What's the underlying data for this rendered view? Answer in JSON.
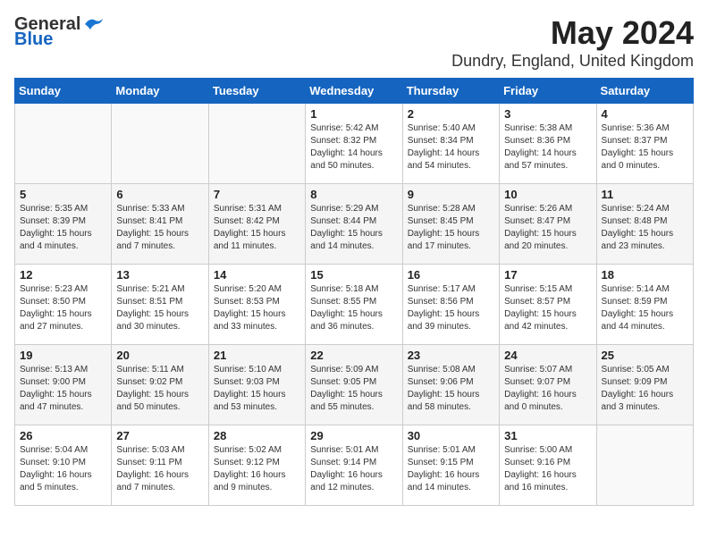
{
  "header": {
    "logo_general": "General",
    "logo_blue": "Blue",
    "month": "May 2024",
    "location": "Dundry, England, United Kingdom"
  },
  "days_of_week": [
    "Sunday",
    "Monday",
    "Tuesday",
    "Wednesday",
    "Thursday",
    "Friday",
    "Saturday"
  ],
  "weeks": [
    [
      {
        "day": "",
        "info": ""
      },
      {
        "day": "",
        "info": ""
      },
      {
        "day": "",
        "info": ""
      },
      {
        "day": "1",
        "info": "Sunrise: 5:42 AM\nSunset: 8:32 PM\nDaylight: 14 hours\nand 50 minutes."
      },
      {
        "day": "2",
        "info": "Sunrise: 5:40 AM\nSunset: 8:34 PM\nDaylight: 14 hours\nand 54 minutes."
      },
      {
        "day": "3",
        "info": "Sunrise: 5:38 AM\nSunset: 8:36 PM\nDaylight: 14 hours\nand 57 minutes."
      },
      {
        "day": "4",
        "info": "Sunrise: 5:36 AM\nSunset: 8:37 PM\nDaylight: 15 hours\nand 0 minutes."
      }
    ],
    [
      {
        "day": "5",
        "info": "Sunrise: 5:35 AM\nSunset: 8:39 PM\nDaylight: 15 hours\nand 4 minutes."
      },
      {
        "day": "6",
        "info": "Sunrise: 5:33 AM\nSunset: 8:41 PM\nDaylight: 15 hours\nand 7 minutes."
      },
      {
        "day": "7",
        "info": "Sunrise: 5:31 AM\nSunset: 8:42 PM\nDaylight: 15 hours\nand 11 minutes."
      },
      {
        "day": "8",
        "info": "Sunrise: 5:29 AM\nSunset: 8:44 PM\nDaylight: 15 hours\nand 14 minutes."
      },
      {
        "day": "9",
        "info": "Sunrise: 5:28 AM\nSunset: 8:45 PM\nDaylight: 15 hours\nand 17 minutes."
      },
      {
        "day": "10",
        "info": "Sunrise: 5:26 AM\nSunset: 8:47 PM\nDaylight: 15 hours\nand 20 minutes."
      },
      {
        "day": "11",
        "info": "Sunrise: 5:24 AM\nSunset: 8:48 PM\nDaylight: 15 hours\nand 23 minutes."
      }
    ],
    [
      {
        "day": "12",
        "info": "Sunrise: 5:23 AM\nSunset: 8:50 PM\nDaylight: 15 hours\nand 27 minutes."
      },
      {
        "day": "13",
        "info": "Sunrise: 5:21 AM\nSunset: 8:51 PM\nDaylight: 15 hours\nand 30 minutes."
      },
      {
        "day": "14",
        "info": "Sunrise: 5:20 AM\nSunset: 8:53 PM\nDaylight: 15 hours\nand 33 minutes."
      },
      {
        "day": "15",
        "info": "Sunrise: 5:18 AM\nSunset: 8:55 PM\nDaylight: 15 hours\nand 36 minutes."
      },
      {
        "day": "16",
        "info": "Sunrise: 5:17 AM\nSunset: 8:56 PM\nDaylight: 15 hours\nand 39 minutes."
      },
      {
        "day": "17",
        "info": "Sunrise: 5:15 AM\nSunset: 8:57 PM\nDaylight: 15 hours\nand 42 minutes."
      },
      {
        "day": "18",
        "info": "Sunrise: 5:14 AM\nSunset: 8:59 PM\nDaylight: 15 hours\nand 44 minutes."
      }
    ],
    [
      {
        "day": "19",
        "info": "Sunrise: 5:13 AM\nSunset: 9:00 PM\nDaylight: 15 hours\nand 47 minutes."
      },
      {
        "day": "20",
        "info": "Sunrise: 5:11 AM\nSunset: 9:02 PM\nDaylight: 15 hours\nand 50 minutes."
      },
      {
        "day": "21",
        "info": "Sunrise: 5:10 AM\nSunset: 9:03 PM\nDaylight: 15 hours\nand 53 minutes."
      },
      {
        "day": "22",
        "info": "Sunrise: 5:09 AM\nSunset: 9:05 PM\nDaylight: 15 hours\nand 55 minutes."
      },
      {
        "day": "23",
        "info": "Sunrise: 5:08 AM\nSunset: 9:06 PM\nDaylight: 15 hours\nand 58 minutes."
      },
      {
        "day": "24",
        "info": "Sunrise: 5:07 AM\nSunset: 9:07 PM\nDaylight: 16 hours\nand 0 minutes."
      },
      {
        "day": "25",
        "info": "Sunrise: 5:05 AM\nSunset: 9:09 PM\nDaylight: 16 hours\nand 3 minutes."
      }
    ],
    [
      {
        "day": "26",
        "info": "Sunrise: 5:04 AM\nSunset: 9:10 PM\nDaylight: 16 hours\nand 5 minutes."
      },
      {
        "day": "27",
        "info": "Sunrise: 5:03 AM\nSunset: 9:11 PM\nDaylight: 16 hours\nand 7 minutes."
      },
      {
        "day": "28",
        "info": "Sunrise: 5:02 AM\nSunset: 9:12 PM\nDaylight: 16 hours\nand 9 minutes."
      },
      {
        "day": "29",
        "info": "Sunrise: 5:01 AM\nSunset: 9:14 PM\nDaylight: 16 hours\nand 12 minutes."
      },
      {
        "day": "30",
        "info": "Sunrise: 5:01 AM\nSunset: 9:15 PM\nDaylight: 16 hours\nand 14 minutes."
      },
      {
        "day": "31",
        "info": "Sunrise: 5:00 AM\nSunset: 9:16 PM\nDaylight: 16 hours\nand 16 minutes."
      },
      {
        "day": "",
        "info": ""
      }
    ]
  ]
}
